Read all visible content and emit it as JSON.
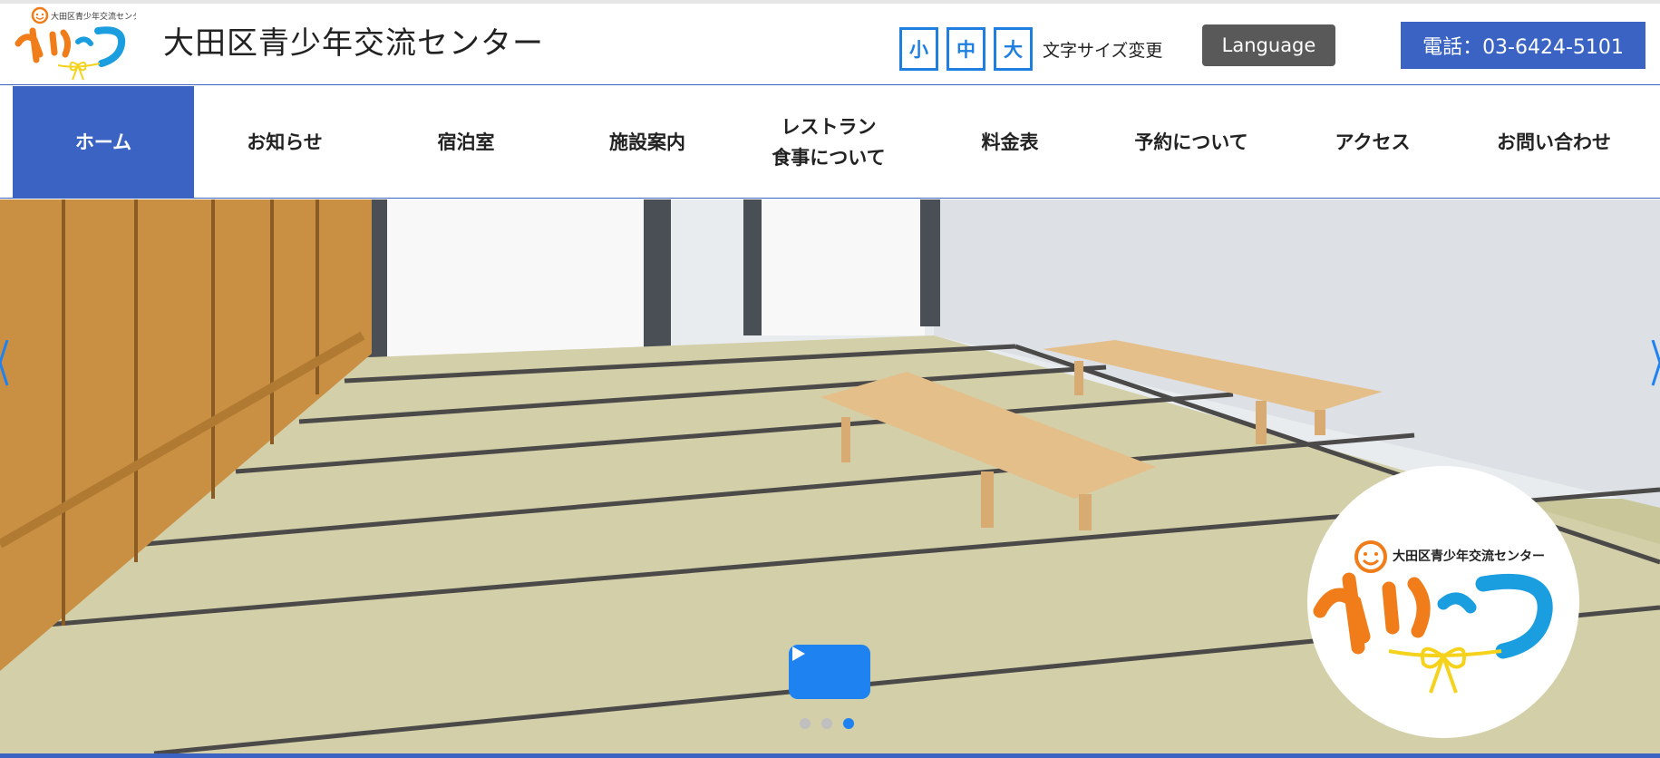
{
  "header": {
    "logo_small_text": "大田区青少年交流センター",
    "logo_text": "ゆいっつ",
    "site_title": "大田区青少年交流センター",
    "font_size": {
      "small": "小",
      "medium": "中",
      "large": "大",
      "label": "文字サイズ変更"
    },
    "language_label": "Language",
    "phone_label": "電話：03-6424-5101"
  },
  "nav": {
    "items": [
      {
        "label": "ホーム",
        "active": true
      },
      {
        "label": "お知らせ"
      },
      {
        "label": "宿泊室"
      },
      {
        "label": "施設案内"
      },
      {
        "label_line1": "レストラン",
        "label_line2": "食事について"
      },
      {
        "label": "料金表"
      },
      {
        "label": "予約について"
      },
      {
        "label": "アクセス"
      },
      {
        "label": "お問い合わせ"
      }
    ]
  },
  "hero": {
    "badge_small_text": "大田区青少年交流センター",
    "badge_logo_text": "ゆいっつ",
    "slides_total": 3,
    "active_slide": 3
  },
  "colors": {
    "brand_blue": "#3a63c4",
    "accent_blue": "#1e7fe0",
    "logo_orange": "#f07c1a",
    "logo_cyan": "#1a9ee0",
    "ribbon_yellow": "#f5d21c"
  },
  "icons": {
    "play": "play-icon",
    "prev": "chevron-left-icon",
    "next": "chevron-right-icon"
  }
}
